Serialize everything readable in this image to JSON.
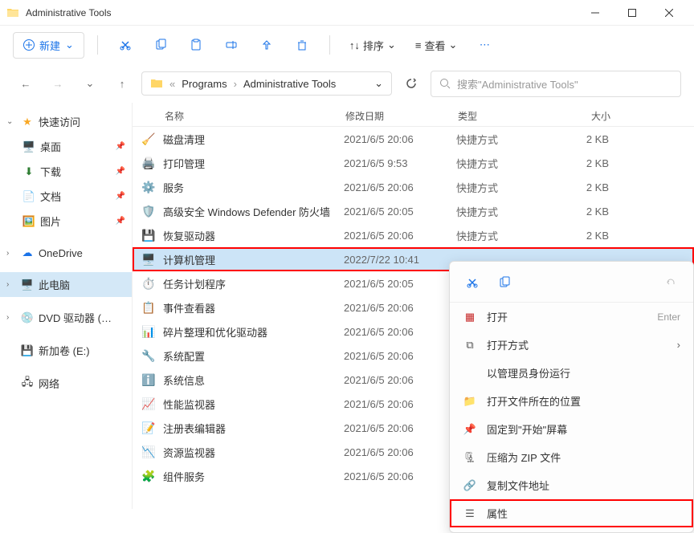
{
  "window": {
    "title": "Administrative Tools"
  },
  "toolbar": {
    "new_label": "新建",
    "sort_label": "排序",
    "view_label": "查看"
  },
  "breadcrumb": {
    "sep": "«",
    "items": [
      "Programs",
      "Administrative Tools"
    ]
  },
  "search": {
    "placeholder": "搜索\"Administrative Tools\""
  },
  "columns": {
    "name": "名称",
    "date": "修改日期",
    "type": "类型",
    "size": "大小"
  },
  "sidebar": {
    "quick_access": "快速访问",
    "desktop": "桌面",
    "downloads": "下载",
    "documents": "文档",
    "pictures": "图片",
    "onedrive": "OneDrive",
    "this_pc": "此电脑",
    "dvd": "DVD 驱动器 (D:) CC",
    "volume": "新加卷 (E:)",
    "network": "网络"
  },
  "files": [
    {
      "name": "磁盘清理",
      "date": "2021/6/5 20:06",
      "type": "快捷方式",
      "size": "2 KB",
      "icon": "🧹"
    },
    {
      "name": "打印管理",
      "date": "2021/6/5 9:53",
      "type": "快捷方式",
      "size": "2 KB",
      "icon": "🖨️"
    },
    {
      "name": "服务",
      "date": "2021/6/5 20:06",
      "type": "快捷方式",
      "size": "2 KB",
      "icon": "⚙️"
    },
    {
      "name": "高级安全 Windows Defender 防火墙",
      "date": "2021/6/5 20:05",
      "type": "快捷方式",
      "size": "2 KB",
      "icon": "🛡️"
    },
    {
      "name": "恢复驱动器",
      "date": "2021/6/5 20:06",
      "type": "快捷方式",
      "size": "2 KB",
      "icon": "💾"
    },
    {
      "name": "计算机管理",
      "date": "2022/7/22 10:41",
      "type": "",
      "size": "",
      "icon": "🖥️",
      "highlighted": true,
      "selected": true
    },
    {
      "name": "任务计划程序",
      "date": "2021/6/5 20:05",
      "type": "",
      "size": "",
      "icon": "⏱️"
    },
    {
      "name": "事件查看器",
      "date": "2021/6/5 20:06",
      "type": "",
      "size": "",
      "icon": "📋"
    },
    {
      "name": "碎片整理和优化驱动器",
      "date": "2021/6/5 20:06",
      "type": "",
      "size": "",
      "icon": "📊"
    },
    {
      "name": "系统配置",
      "date": "2021/6/5 20:06",
      "type": "",
      "size": "",
      "icon": "🔧"
    },
    {
      "name": "系统信息",
      "date": "2021/6/5 20:06",
      "type": "",
      "size": "",
      "icon": "ℹ️"
    },
    {
      "name": "性能监视器",
      "date": "2021/6/5 20:06",
      "type": "",
      "size": "",
      "icon": "📈"
    },
    {
      "name": "注册表编辑器",
      "date": "2021/6/5 20:06",
      "type": "",
      "size": "",
      "icon": "📝"
    },
    {
      "name": "资源监视器",
      "date": "2021/6/5 20:06",
      "type": "",
      "size": "",
      "icon": "📉"
    },
    {
      "name": "组件服务",
      "date": "2021/6/5 20:06",
      "type": "",
      "size": "",
      "icon": "🧩"
    }
  ],
  "context_menu": {
    "open": "打开",
    "open_shortcut": "Enter",
    "open_with": "打开方式",
    "run_as_admin": "以管理员身份运行",
    "open_location": "打开文件所在的位置",
    "pin_to_start": "固定到\"开始\"屏幕",
    "compress_zip": "压缩为 ZIP 文件",
    "copy_path": "复制文件地址",
    "properties": "属性"
  }
}
